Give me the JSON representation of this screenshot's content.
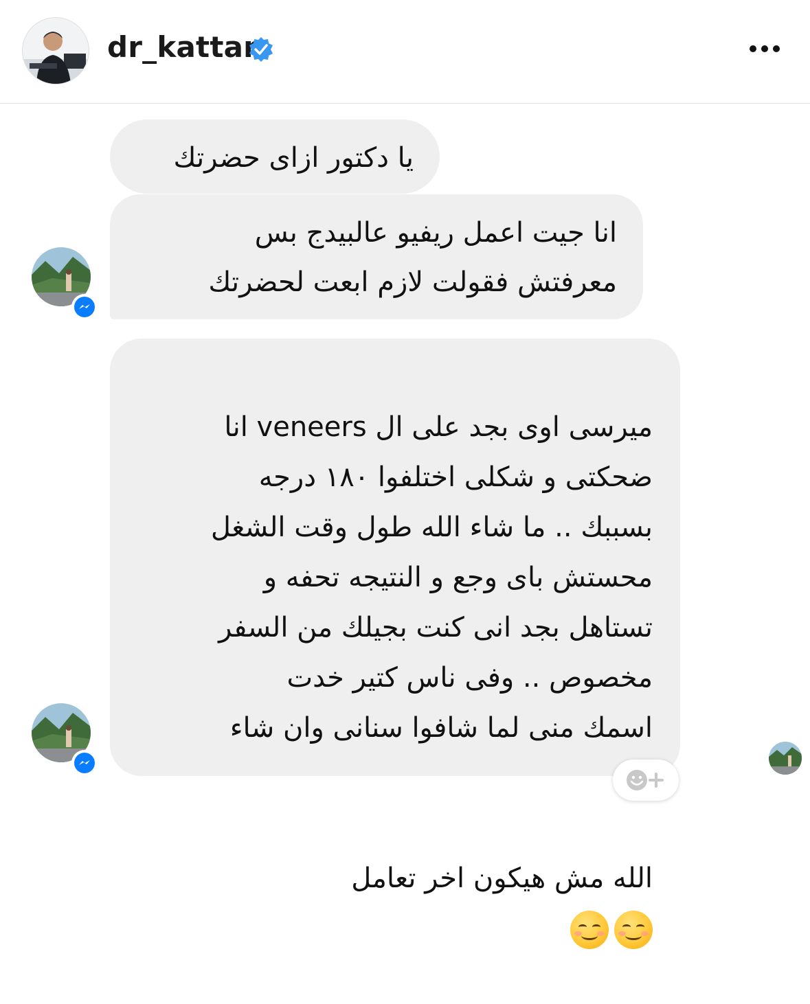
{
  "header": {
    "username": "dr_kattan",
    "verified_color": "#3897f0",
    "more_icon": "more-horizontal-icon"
  },
  "messages": [
    {
      "text": "يا دكتور ازاى حضرتك"
    },
    {
      "text": "انا جيت اعمل ريفيو عالبيدج بس\nمعرفتش فقولت لازم ابعت لحضرتك"
    },
    {
      "text": "ميرسى اوى بجد على ال veneers انا\nضحكتى و شكلى اختلفوا ١٨٠ درجه\nبسببك .. ما شاء الله طول وقت الشغل\nمحستش باى وجع و النتيجه تحفه و\nتستاهل بجد انى كنت بجيلك من السفر\nمخصوص .. وفى ناس كتير خدت\nاسمك منى لما شافوا سنانى وان شاء",
      "last_line": "الله مش هيكون اخر تعامل",
      "emoji": "smiling-face-icon"
    }
  ],
  "colors": {
    "bubble_bg": "#efefef",
    "messenger_blue": "#0a7cff"
  }
}
